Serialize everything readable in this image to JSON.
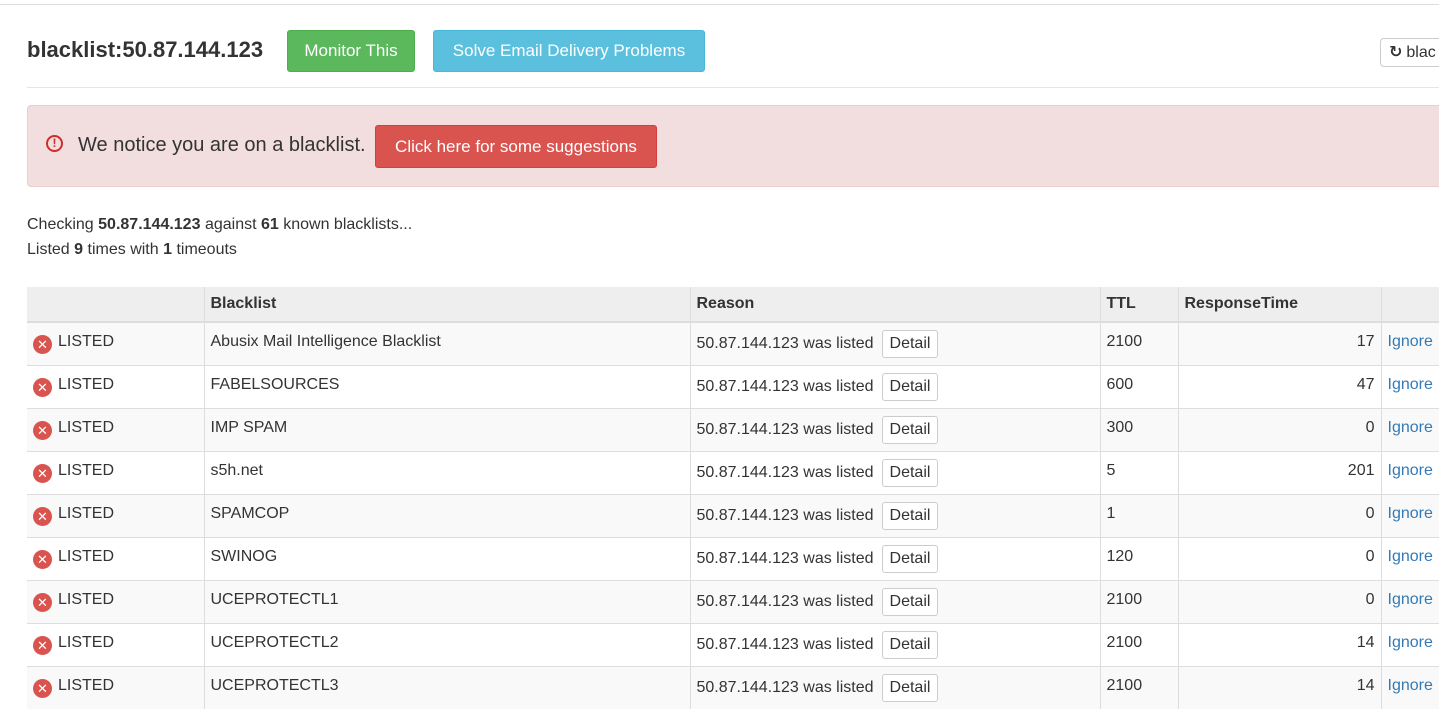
{
  "header": {
    "title": "blacklist:50.87.144.123",
    "monitor_label": "Monitor This",
    "solve_label": "Solve Email Delivery Problems",
    "refresh_label": "blac"
  },
  "alert": {
    "icon": "exclamation-circle-icon",
    "message": "We notice you are on a blacklist.",
    "suggest_label": "Click here for some suggestions"
  },
  "summary": {
    "checking_prefix": "Checking",
    "ip": "50.87.144.123",
    "against": "against",
    "count": "61",
    "known": "known blacklists...",
    "listed_prefix": "Listed",
    "listed_count": "9",
    "times_with": "times with",
    "timeouts_count": "1",
    "timeouts": "timeouts"
  },
  "table": {
    "headers": [
      "",
      "Blacklist",
      "Reason",
      "TTL",
      "ResponseTime",
      ""
    ],
    "detail_label": "Detail",
    "ignore_label": "Ignore",
    "rows": [
      {
        "status": "LISTED",
        "blacklist": "Abusix Mail Intelligence Blacklist",
        "reason": "50.87.144.123 was listed",
        "ttl": "2100",
        "response": "17"
      },
      {
        "status": "LISTED",
        "blacklist": "FABELSOURCES",
        "reason": "50.87.144.123 was listed",
        "ttl": "600",
        "response": "47"
      },
      {
        "status": "LISTED",
        "blacklist": "IMP SPAM",
        "reason": "50.87.144.123 was listed",
        "ttl": "300",
        "response": "0"
      },
      {
        "status": "LISTED",
        "blacklist": "s5h.net",
        "reason": "50.87.144.123 was listed",
        "ttl": "5",
        "response": "201"
      },
      {
        "status": "LISTED",
        "blacklist": "SPAMCOP",
        "reason": "50.87.144.123 was listed",
        "ttl": "1",
        "response": "0"
      },
      {
        "status": "LISTED",
        "blacklist": "SWINOG",
        "reason": "50.87.144.123 was listed",
        "ttl": "120",
        "response": "0"
      },
      {
        "status": "LISTED",
        "blacklist": "UCEPROTECTL1",
        "reason": "50.87.144.123 was listed",
        "ttl": "2100",
        "response": "0"
      },
      {
        "status": "LISTED",
        "blacklist": "UCEPROTECTL2",
        "reason": "50.87.144.123 was listed",
        "ttl": "2100",
        "response": "14"
      },
      {
        "status": "LISTED",
        "blacklist": "UCEPROTECTL3",
        "reason": "50.87.144.123 was listed",
        "ttl": "2100",
        "response": "14"
      }
    ]
  },
  "colors": {
    "success": "#5cb85c",
    "info": "#5bc0de",
    "danger": "#d9534f",
    "alert_bg": "#f2dede",
    "link": "#337ab7"
  }
}
